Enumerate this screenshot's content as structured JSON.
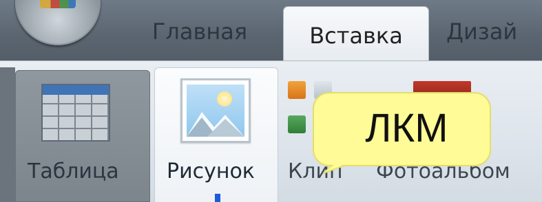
{
  "tabs": {
    "home_label": "Главная",
    "insert_label": "Вставка",
    "design_label": "Дизай"
  },
  "ribbon": {
    "table_label": "Таблица",
    "picture_label": "Рисунок",
    "clip_label": "Клип",
    "album_label": "Фотоальбом"
  },
  "callout": {
    "text": "ЛКМ"
  },
  "colors": {
    "active_tab": "#f7f9fb",
    "callout_bg": "#fffb96",
    "tabstrip": "#5b6671"
  }
}
